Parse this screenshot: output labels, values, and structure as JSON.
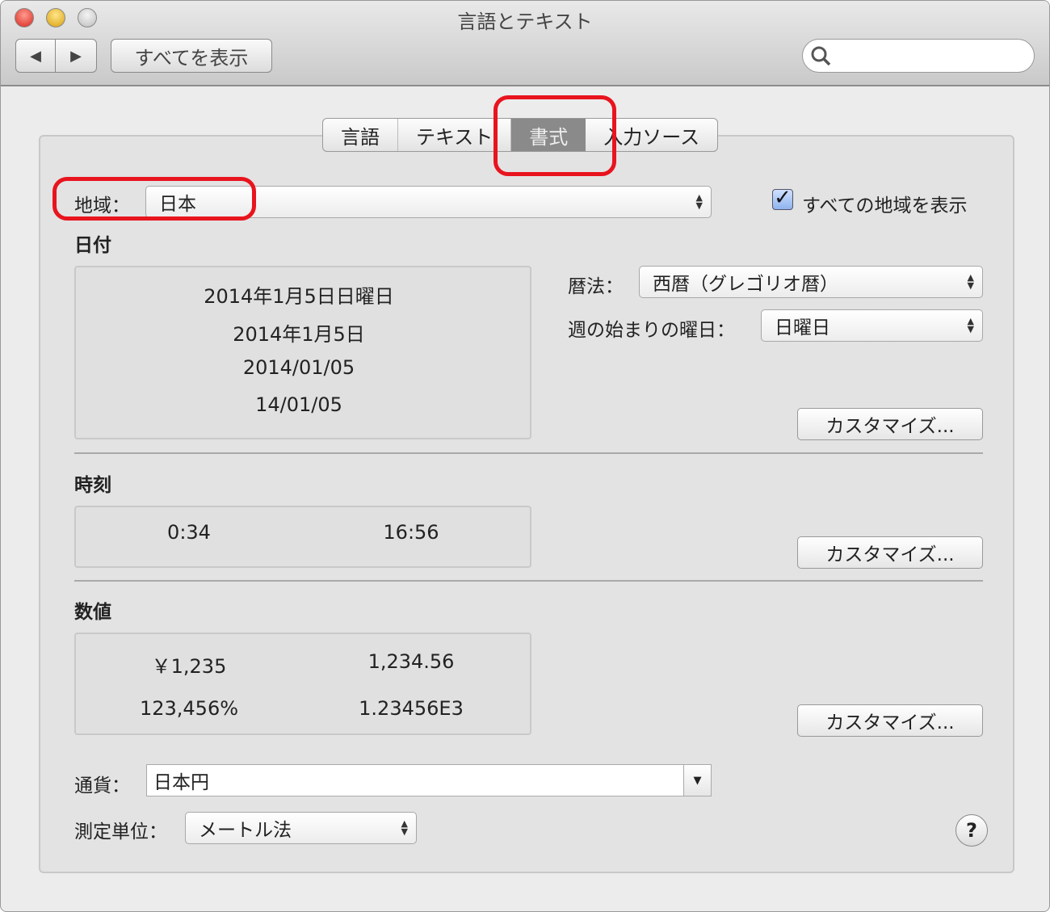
{
  "window": {
    "title": "言語とテキスト"
  },
  "toolbar": {
    "back": "◀",
    "forward": "▶",
    "show_all": "すべてを表示",
    "search_placeholder": ""
  },
  "tabs": [
    {
      "label": "言語"
    },
    {
      "label": "テキスト"
    },
    {
      "label": "書式",
      "selected": true
    },
    {
      "label": "入力ソース"
    }
  ],
  "region": {
    "label": "地域：",
    "value": "日本",
    "show_all_label": "すべての地域を表示",
    "show_all_checked": true
  },
  "date": {
    "heading": "日付",
    "samples": [
      "2014年1月5日日曜日",
      "2014年1月5日",
      "2014/01/05",
      "14/01/05"
    ],
    "calendar_label": "暦法：",
    "calendar_value": "西暦（グレゴリオ暦）",
    "week_start_label": "週の始まりの曜日：",
    "week_start_value": "日曜日",
    "customize": "カスタマイズ..."
  },
  "time": {
    "heading": "時刻",
    "samples": [
      "0:34",
      "16:56"
    ],
    "customize": "カスタマイズ..."
  },
  "numbers": {
    "heading": "数値",
    "samples": [
      "￥1,235",
      "1,234.56",
      "123,456%",
      "1.23456E3"
    ],
    "customize": "カスタマイズ..."
  },
  "currency": {
    "label": "通貨：",
    "value": "日本円"
  },
  "measure": {
    "label": "測定単位：",
    "value": "メートル法"
  },
  "help": "?",
  "colors": {
    "highlight": "#e8141e"
  }
}
